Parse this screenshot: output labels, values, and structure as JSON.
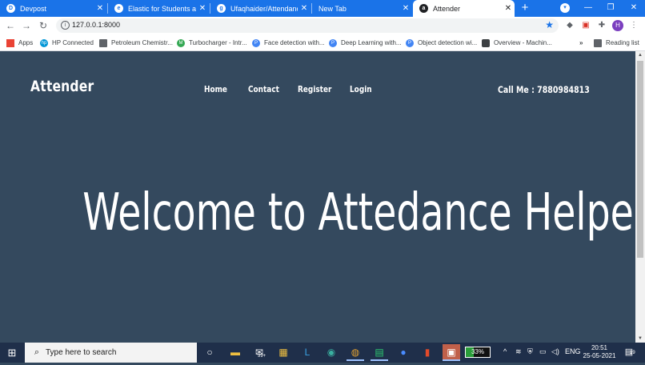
{
  "browser": {
    "tabs": [
      {
        "title": "Devpost",
        "fav": "D"
      },
      {
        "title": "Elastic for Students and E",
        "fav": "e"
      },
      {
        "title": "Ufaqhaider/Attendance-S",
        "fav": "g"
      },
      {
        "title": "New Tab",
        "fav": ""
      },
      {
        "title": "Attender",
        "fav": "a"
      }
    ],
    "url": "127.0.0.1:8000",
    "bookmarks": [
      {
        "label": "Apps",
        "icon": "apps-grid-icon",
        "color": "#ea4335"
      },
      {
        "label": "HP Connected",
        "icon": "hp-icon",
        "color": "#0096d6"
      },
      {
        "label": "Petroleum Chemistr...",
        "icon": "building-icon",
        "color": "#5f6368"
      },
      {
        "label": "Turbocharger - Intr...",
        "icon": "m-logo-icon",
        "color": "#34a853"
      },
      {
        "label": "Face detection with...",
        "icon": "p-icon",
        "color": "#4285f4"
      },
      {
        "label": "Deep Learning with...",
        "icon": "p-icon",
        "color": "#4285f4"
      },
      {
        "label": "Object detection wi...",
        "icon": "p-icon",
        "color": "#4285f4"
      },
      {
        "label": "Overview - Machin...",
        "icon": "page-icon",
        "color": "#3c4043"
      }
    ],
    "more_bookmarks": "»",
    "reading_list": "Reading list",
    "profile_initial": "H"
  },
  "site": {
    "brand": "Attender",
    "nav": [
      "Home",
      "Contact",
      "Register",
      "Login"
    ],
    "phone": "Call Me : 7880984813",
    "hero": "Welcome to Attedance Helper",
    "background": "#34495e"
  },
  "taskbar": {
    "search_placeholder": "Type here to search",
    "mail_badge": "99+",
    "battery": "33%",
    "language": "ENG",
    "time": "20:51",
    "date": "25-05-2021",
    "notifications": "19"
  }
}
